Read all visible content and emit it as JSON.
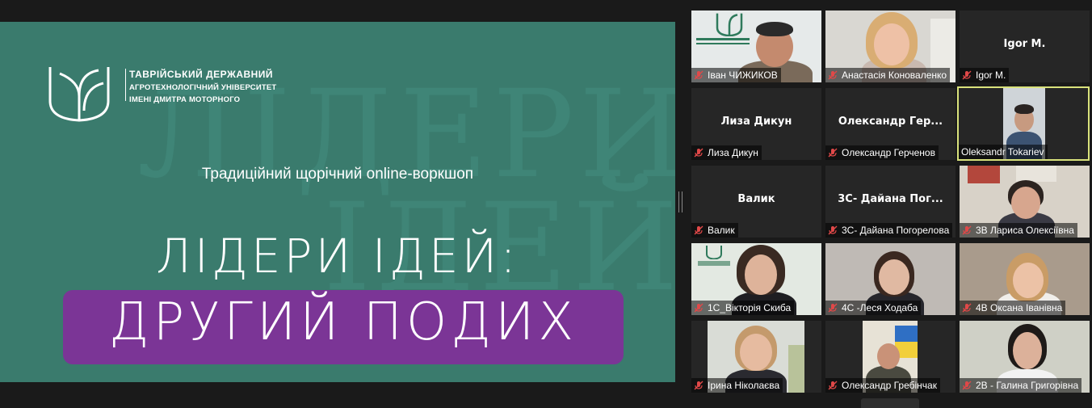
{
  "slide": {
    "watermark_line1": "ЛІДЕРИ",
    "watermark_line2": "ІДЕЙ",
    "university_line1": "ТАВРІЙСЬКИЙ ДЕРЖАВНИЙ",
    "university_line2": "АГРОТЕХНОЛОГІЧНИЙ УНІВЕРСИТЕТ",
    "university_line3": "ІМЕНІ ДМИТРА МОТОРНОГО",
    "subtitle": "Традиційний щорічний online-воркшоп",
    "headline1": "ЛІДЕРИ ІДЕЙ:",
    "headline2": "ДРУГИЙ ПОДИХ",
    "colors": {
      "background": "#3a7b6d",
      "pill": "#7b3596"
    }
  },
  "participants": [
    {
      "label": "Іван ЧИЖИКОВ",
      "center": "",
      "muted": true,
      "active": false
    },
    {
      "label": "Анастасія Коноваленко",
      "center": "",
      "muted": true,
      "active": false
    },
    {
      "label": "Igor M.",
      "center": "Igor M.",
      "muted": true,
      "active": false
    },
    {
      "label": "Лиза Дикун",
      "center": "Лиза Дикун",
      "muted": true,
      "active": false
    },
    {
      "label": "Олександр Герченов",
      "center": "Олександр  Гер...",
      "muted": true,
      "active": false
    },
    {
      "label": "Oleksandr Tokariev",
      "center": "",
      "muted": false,
      "active": true
    },
    {
      "label": "Валик",
      "center": "Валик",
      "muted": true,
      "active": false
    },
    {
      "label": "3С- Дайана Погорелова",
      "center": "3С-  Дайана  Пог...",
      "muted": true,
      "active": false
    },
    {
      "label": "3В Лариса Олексіївна",
      "center": "",
      "muted": true,
      "active": false
    },
    {
      "label": "1С_Вікторія Скиба",
      "center": "",
      "muted": true,
      "active": false
    },
    {
      "label": "4С -Леся Ходаба",
      "center": "",
      "muted": true,
      "active": false
    },
    {
      "label": "4В Оксана Іванівна",
      "center": "",
      "muted": true,
      "active": false
    },
    {
      "label": "Ірина Ніколаєва",
      "center": "",
      "muted": true,
      "active": false
    },
    {
      "label": "Олександр Гребінчак",
      "center": "",
      "muted": true,
      "active": false
    },
    {
      "label": "2В - Галина Григорівна",
      "center": "",
      "muted": true,
      "active": false
    }
  ]
}
